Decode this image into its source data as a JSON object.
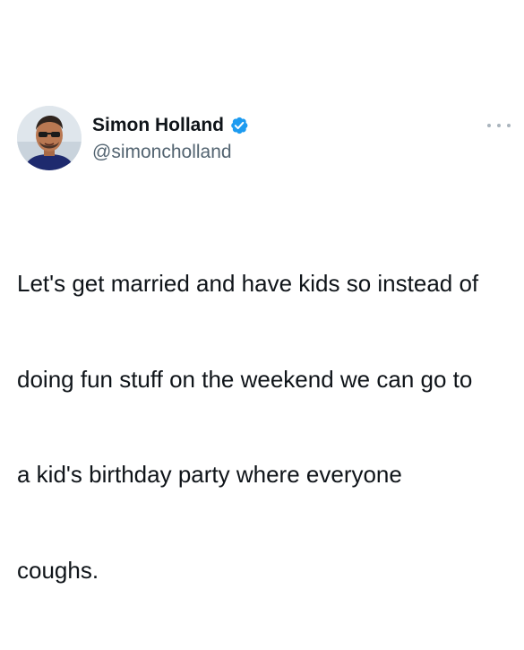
{
  "tweet": {
    "display_name": "Simon Holland",
    "handle": "@simoncholland",
    "verified": true,
    "text_lines": [
      "Let's get married and have kids so instead of",
      "doing fun stuff on the weekend we can go to",
      "a kid's birthday party where everyone",
      "coughs."
    ]
  },
  "icons": {
    "verified": "verified-badge-icon",
    "more": "more-options-icon",
    "avatar": "profile-avatar"
  },
  "colors": {
    "verified_blue": "#1d9bf0",
    "handle_gray": "#536471",
    "text": "#0f1419",
    "dots": "#a9b4bd"
  }
}
